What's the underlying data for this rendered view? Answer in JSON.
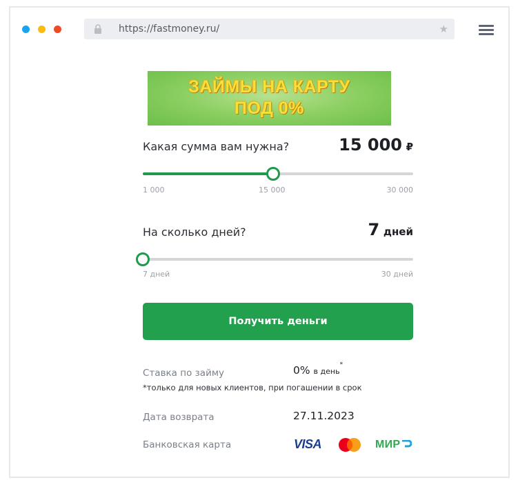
{
  "browser": {
    "url": "https://fastmoney.ru/"
  },
  "banner": {
    "line1": "ЗАЙМЫ НА КАРТУ",
    "line2": "ПОД 0%"
  },
  "amount": {
    "question": "Какая сумма вам нужна?",
    "value": "15 000",
    "currency": "₽",
    "min_label": "1 000",
    "mid_label": "15 000",
    "max_label": "30 000",
    "slider_fraction": 0.483
  },
  "days": {
    "question": "На сколько дней?",
    "value": "7",
    "unit": "дней",
    "min_label": "7 дней",
    "max_label": "30 дней",
    "slider_fraction": 0.0
  },
  "cta": {
    "label": "Получить деньги"
  },
  "rate": {
    "label": "Ставка по займу",
    "value": "0%",
    "per": "в день",
    "footnote_mark": "*",
    "note": "*только для новых клиентов, при погашении в срок"
  },
  "return_date": {
    "label": "Дата возврата",
    "value": "27.11.2023"
  },
  "card": {
    "label": "Банковская карта",
    "logos": {
      "visa": "VISA",
      "mastercard": "mastercard-logo",
      "mir": "МИР"
    }
  },
  "colors": {
    "accent": "#23a04e",
    "slider": "#1d9a4a",
    "track": "#d4d6d9"
  }
}
